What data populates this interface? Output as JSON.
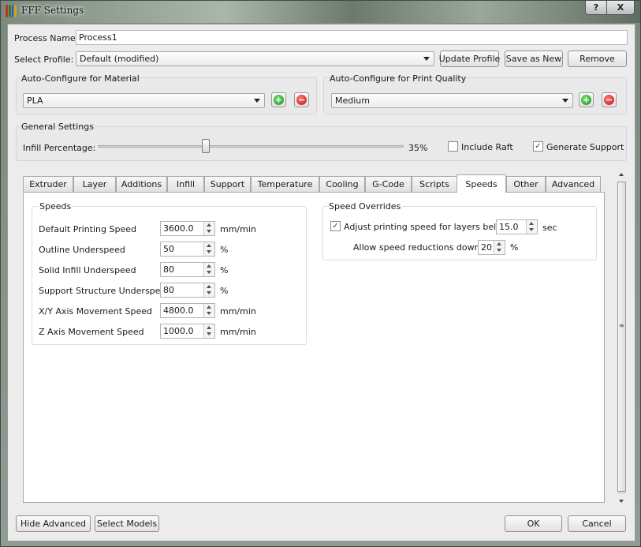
{
  "window": {
    "title": "FFF Settings",
    "help_label": "?",
    "close_label": "X"
  },
  "process": {
    "name_label": "Process Name:",
    "name_value": "Process1",
    "profile_label": "Select Profile:",
    "profile_value": "Default (modified)",
    "update_profile_label": "Update Profile",
    "save_as_new_label": "Save as New",
    "remove_label": "Remove"
  },
  "material": {
    "title": "Auto-Configure for Material",
    "value": "PLA"
  },
  "quality": {
    "title": "Auto-Configure for Print Quality",
    "value": "Medium"
  },
  "general": {
    "title": "General Settings",
    "infill_label": "Infill Percentage:",
    "infill_value": 35,
    "infill_text": "35%",
    "include_raft_label": "Include Raft",
    "include_raft_checked": false,
    "generate_support_label": "Generate Support",
    "generate_support_checked": true
  },
  "tabs": [
    {
      "label": "Extruder"
    },
    {
      "label": "Layer"
    },
    {
      "label": "Additions"
    },
    {
      "label": "Infill"
    },
    {
      "label": "Support"
    },
    {
      "label": "Temperature"
    },
    {
      "label": "Cooling"
    },
    {
      "label": "G-Code"
    },
    {
      "label": "Scripts"
    },
    {
      "label": "Speeds"
    },
    {
      "label": "Other"
    },
    {
      "label": "Advanced"
    }
  ],
  "active_tab": "Speeds",
  "speeds": {
    "title": "Speeds",
    "rows": [
      {
        "label": "Default Printing Speed",
        "value": "3600.0",
        "unit": "mm/min"
      },
      {
        "label": "Outline Underspeed",
        "value": "50",
        "unit": "%"
      },
      {
        "label": "Solid Infill Underspeed",
        "value": "80",
        "unit": "%"
      },
      {
        "label": "Support Structure Underspeed",
        "value": "80",
        "unit": "%"
      },
      {
        "label": "X/Y Axis Movement Speed",
        "value": "4800.0",
        "unit": "mm/min"
      },
      {
        "label": "Z Axis Movement Speed",
        "value": "1000.0",
        "unit": "mm/min"
      }
    ]
  },
  "overrides": {
    "title": "Speed Overrides",
    "adjust_label": "Adjust printing speed for layers below",
    "adjust_checked": true,
    "adjust_value": "15.0",
    "adjust_unit": "sec",
    "allow_label": "Allow speed reductions down to",
    "allow_value": "20",
    "allow_unit": "%"
  },
  "footer": {
    "hide_advanced_label": "Hide Advanced",
    "select_models_label": "Select Models",
    "ok_label": "OK",
    "cancel_label": "Cancel"
  },
  "icons": {
    "check_glyph": "✓",
    "add_glyph": "+",
    "remove_glyph": "−",
    "grip_glyph": "≡"
  },
  "colors": {
    "icon_bars": [
      "#c0332b",
      "#2f7d3a",
      "#2a5fb3",
      "#d8a21d"
    ]
  }
}
